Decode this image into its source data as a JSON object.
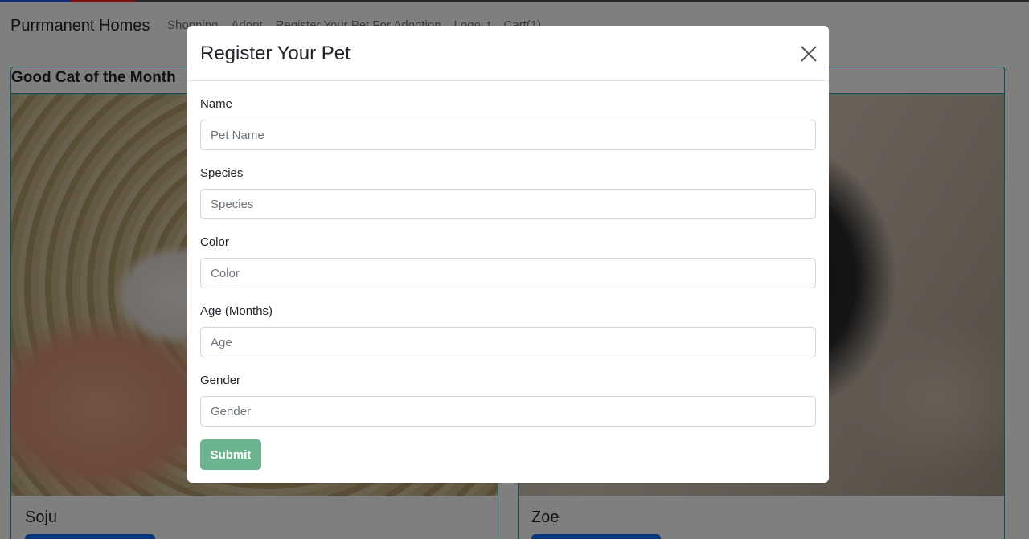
{
  "navbar": {
    "brand": "Purrmanent Homes",
    "links": [
      "Shopping",
      "Adopt",
      "Register Your Pet For Adoption",
      "Logout",
      "Cart(1)"
    ]
  },
  "background": {
    "section_title": "Good Cat of the Month",
    "cards": [
      {
        "name": "Soju"
      },
      {
        "name": "Zoe"
      }
    ]
  },
  "modal": {
    "title": "Register Your Pet",
    "close_icon": "close-icon",
    "fields": [
      {
        "label": "Name",
        "placeholder": "Pet Name",
        "value": ""
      },
      {
        "label": "Species",
        "placeholder": "Species",
        "value": ""
      },
      {
        "label": "Color",
        "placeholder": "Color",
        "value": ""
      },
      {
        "label": "Age (Months)",
        "placeholder": "Age",
        "value": ""
      },
      {
        "label": "Gender",
        "placeholder": "Gender",
        "value": ""
      }
    ],
    "submit_label": "Submit"
  },
  "colors": {
    "accent_primary": "#0d6efd",
    "submit_button": "#6cb38f",
    "card_border": "#17a2b8"
  }
}
